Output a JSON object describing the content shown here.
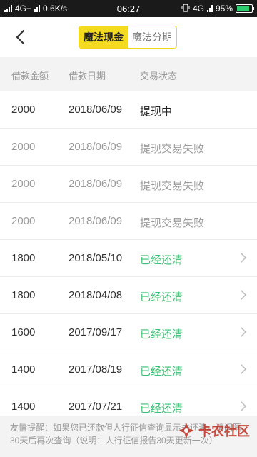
{
  "status_bar": {
    "network": "4G+",
    "speed": "0.6K/s",
    "time": "06:27",
    "network_right": "4G",
    "battery": "95%",
    "battery_level": 0.95
  },
  "nav": {
    "back_icon": "chevron-left-icon",
    "tabs": [
      {
        "label": "魔法现金",
        "active": true
      },
      {
        "label": "魔法分期",
        "active": false
      }
    ]
  },
  "table": {
    "headers": [
      "借款金额",
      "借款日期",
      "交易状态"
    ],
    "rows": [
      {
        "amount": "2000",
        "date": "2018/06/09",
        "status": "提现中",
        "kind": "processing",
        "chevron": false
      },
      {
        "amount": "2000",
        "date": "2018/06/09",
        "status": "提现交易失败",
        "kind": "failed",
        "chevron": false
      },
      {
        "amount": "2000",
        "date": "2018/06/09",
        "status": "提现交易失败",
        "kind": "failed",
        "chevron": false
      },
      {
        "amount": "2000",
        "date": "2018/06/09",
        "status": "提现交易失败",
        "kind": "failed",
        "chevron": false
      },
      {
        "amount": "1800",
        "date": "2018/05/10",
        "status": "已经还清",
        "kind": "cleared",
        "chevron": true
      },
      {
        "amount": "1800",
        "date": "2018/04/08",
        "status": "已经还清",
        "kind": "cleared",
        "chevron": true
      },
      {
        "amount": "1600",
        "date": "2017/09/17",
        "status": "已经还清",
        "kind": "cleared",
        "chevron": true
      },
      {
        "amount": "1400",
        "date": "2017/08/19",
        "status": "已经还清",
        "kind": "cleared",
        "chevron": true
      },
      {
        "amount": "1400",
        "date": "2017/07/21",
        "status": "已经还清",
        "kind": "cleared",
        "chevron": true
      }
    ]
  },
  "notice": {
    "text": "友情提醒：如果您已还款但人行征信查询显示未还清，请间隔30天后再次查询（说明：人行征信报告30天更新一次）"
  },
  "watermark": {
    "text": "卡农社区"
  },
  "colors": {
    "accent_yellow": "#f5db1f",
    "cleared_green": "#38c172",
    "muted_grey": "#9a9a9a"
  }
}
